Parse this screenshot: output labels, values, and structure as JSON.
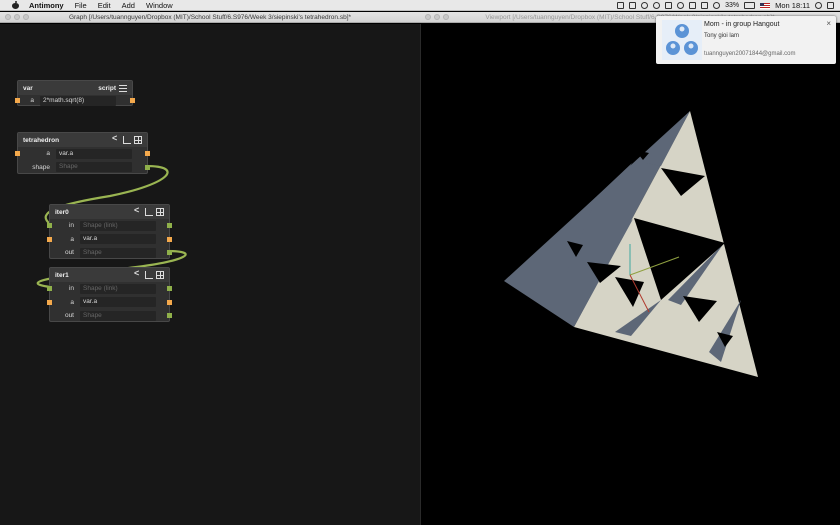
{
  "menubar": {
    "apple": "apple-icon",
    "items": [
      "Antimony",
      "File",
      "Edit",
      "Add",
      "Window"
    ],
    "battery": "33%",
    "clock": "Mon 18:11"
  },
  "graph_window": {
    "title": "Graph [/Users/tuannguyen/Dropbox (MIT)/School Stuff/6.S976/Week 3/siepinski's tetrahedron.sb]*"
  },
  "viewport_window": {
    "title": "Viewport [/Users/tuannguyen/Dropbox (MIT)/School Stuff/6.S976/Week 3/siepinski's tetrahedron.sb]*"
  },
  "nodes": {
    "var": {
      "name": "var",
      "type_label": "script",
      "rows": [
        {
          "label": "a",
          "value": "2*math.sqrt(8)"
        }
      ]
    },
    "tetrahedron": {
      "name": "tetrahedron",
      "rows": [
        {
          "label": "a",
          "value": "var.a"
        },
        {
          "label": "shape",
          "value": "Shape"
        }
      ]
    },
    "iter0": {
      "name": "iter0",
      "rows": [
        {
          "label": "in",
          "value": "Shape (link)"
        },
        {
          "label": "a",
          "value": "var.a"
        },
        {
          "label": "out",
          "value": "Shape"
        }
      ]
    },
    "iter1": {
      "name": "iter1",
      "rows": [
        {
          "label": "in",
          "value": "Shape (link)"
        },
        {
          "label": "a",
          "value": "var.a"
        },
        {
          "label": "out",
          "value": "Shape"
        }
      ]
    }
  },
  "notification": {
    "title": "Mom - in group Hangout",
    "message": "Tony gioi lam",
    "email": "tuannguyen20071844@gmail.com",
    "close": "×"
  },
  "colors": {
    "number_port": "#f4a94c",
    "shape_port": "#8fb04a",
    "wire": "#9ab552",
    "tetra_light": "#d6d4c6",
    "tetra_dark": "#5d6777"
  }
}
